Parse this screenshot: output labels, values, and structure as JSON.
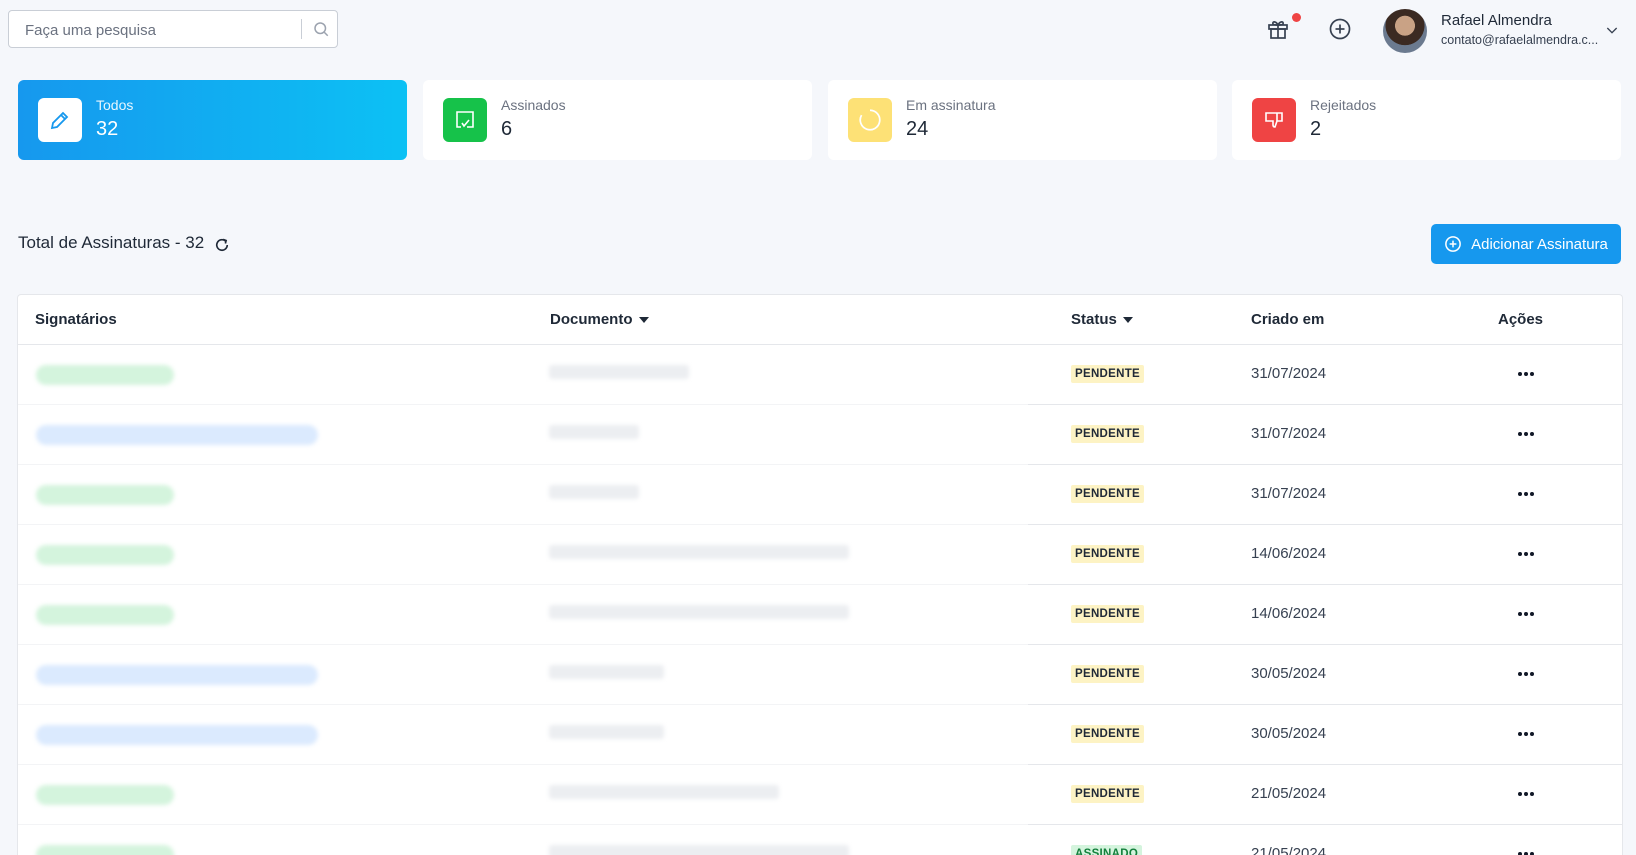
{
  "search": {
    "placeholder": "Faça uma pesquisa",
    "value": ""
  },
  "header": {
    "icons": [
      "gift-icon",
      "add-circle-icon"
    ],
    "user": {
      "name": "Rafael Almendra",
      "email": "contato@rafaelalmendra.c..."
    }
  },
  "cards": [
    {
      "label": "Todos",
      "value": "32",
      "icon": "pencil-icon",
      "color": "#1698ee"
    },
    {
      "label": "Assinados",
      "value": "6",
      "icon": "check-square-icon",
      "color": "#16c24a"
    },
    {
      "label": "Em assinatura",
      "value": "24",
      "icon": "loading-circle-icon",
      "color": "#fde176"
    },
    {
      "label": "Rejeitados",
      "value": "2",
      "icon": "thumbs-down-icon",
      "color": "#ef4444"
    }
  ],
  "section": {
    "title": "Total de Assinaturas - 32",
    "add_button": "Adicionar Assinatura"
  },
  "table": {
    "columns": [
      "Signatários",
      "Documento",
      "Status",
      "Criado em",
      "Ações"
    ],
    "rows": [
      {
        "status": "PENDENTE",
        "date": "31/07/2024"
      },
      {
        "status": "PENDENTE",
        "date": "31/07/2024"
      },
      {
        "status": "PENDENTE",
        "date": "31/07/2024"
      },
      {
        "status": "PENDENTE",
        "date": "14/06/2024"
      },
      {
        "status": "PENDENTE",
        "date": "14/06/2024"
      },
      {
        "status": "PENDENTE",
        "date": "30/05/2024"
      },
      {
        "status": "PENDENTE",
        "date": "30/05/2024"
      },
      {
        "status": "PENDENTE",
        "date": "21/05/2024"
      },
      {
        "status": "ASSINADO",
        "date": "21/05/2024"
      }
    ]
  },
  "colors": {
    "accent": "#1698ee",
    "pending_bg": "#fdf3c4",
    "signed_bg": "#d4f4dd"
  }
}
